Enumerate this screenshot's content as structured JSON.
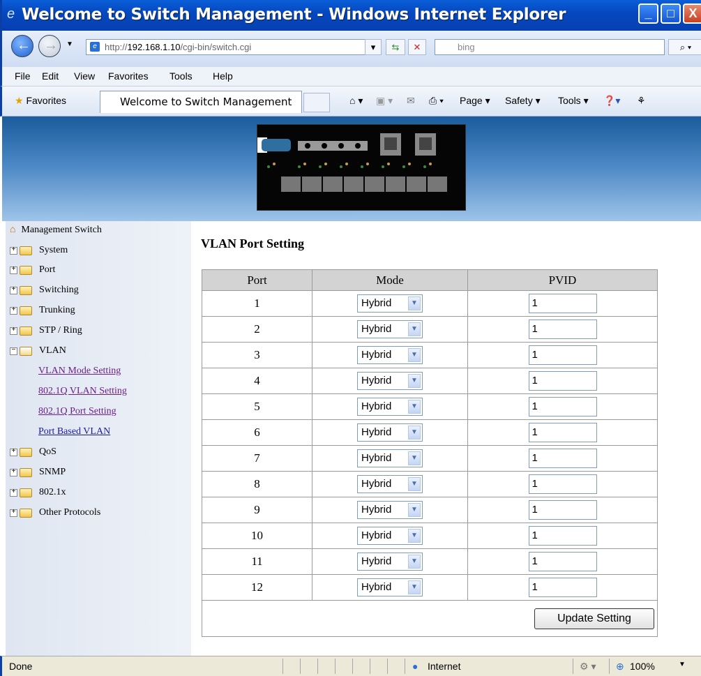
{
  "window": {
    "title": "Welcome to Switch Management - Windows Internet Explorer"
  },
  "address": {
    "url_prefix": "http://",
    "url_host": "192.168.1.10",
    "url_path": "/cgi-bin/switch.cgi",
    "search_placeholder": "bing"
  },
  "menu": {
    "file": "File",
    "edit": "Edit",
    "view": "View",
    "favorites": "Favorites",
    "tools": "Tools",
    "help": "Help"
  },
  "favbar": {
    "favorites": "Favorites",
    "tab_title": "Welcome to Switch Management",
    "page": "Page ▾",
    "safety": "Safety ▾",
    "tools": "Tools ▾"
  },
  "sidebar": {
    "root": "Management Switch",
    "items": [
      "System",
      "Port",
      "Switching",
      "Trunking",
      "STP / Ring",
      "VLAN"
    ],
    "vlan_links": [
      "VLAN Mode Setting",
      "802.1Q VLAN Setting",
      "802.1Q Port Setting",
      "Port Based VLAN"
    ],
    "items_after": [
      "QoS",
      "SNMP",
      "802.1x",
      "Other Protocols"
    ]
  },
  "main": {
    "title": "VLAN Port Setting",
    "headers": [
      "Port",
      "Mode",
      "PVID"
    ],
    "rows": [
      {
        "port": "1",
        "mode": "Hybrid",
        "pvid": "1"
      },
      {
        "port": "2",
        "mode": "Hybrid",
        "pvid": "1"
      },
      {
        "port": "3",
        "mode": "Hybrid",
        "pvid": "1"
      },
      {
        "port": "4",
        "mode": "Hybrid",
        "pvid": "1"
      },
      {
        "port": "5",
        "mode": "Hybrid",
        "pvid": "1"
      },
      {
        "port": "6",
        "mode": "Hybrid",
        "pvid": "1"
      },
      {
        "port": "7",
        "mode": "Hybrid",
        "pvid": "1"
      },
      {
        "port": "8",
        "mode": "Hybrid",
        "pvid": "1"
      },
      {
        "port": "9",
        "mode": "Hybrid",
        "pvid": "1"
      },
      {
        "port": "10",
        "mode": "Hybrid",
        "pvid": "1"
      },
      {
        "port": "11",
        "mode": "Hybrid",
        "pvid": "1"
      },
      {
        "port": "12",
        "mode": "Hybrid",
        "pvid": "1"
      }
    ],
    "update_button": "Update Setting"
  },
  "status": {
    "left": "Done",
    "zone": "Internet",
    "zoom": "100%"
  }
}
